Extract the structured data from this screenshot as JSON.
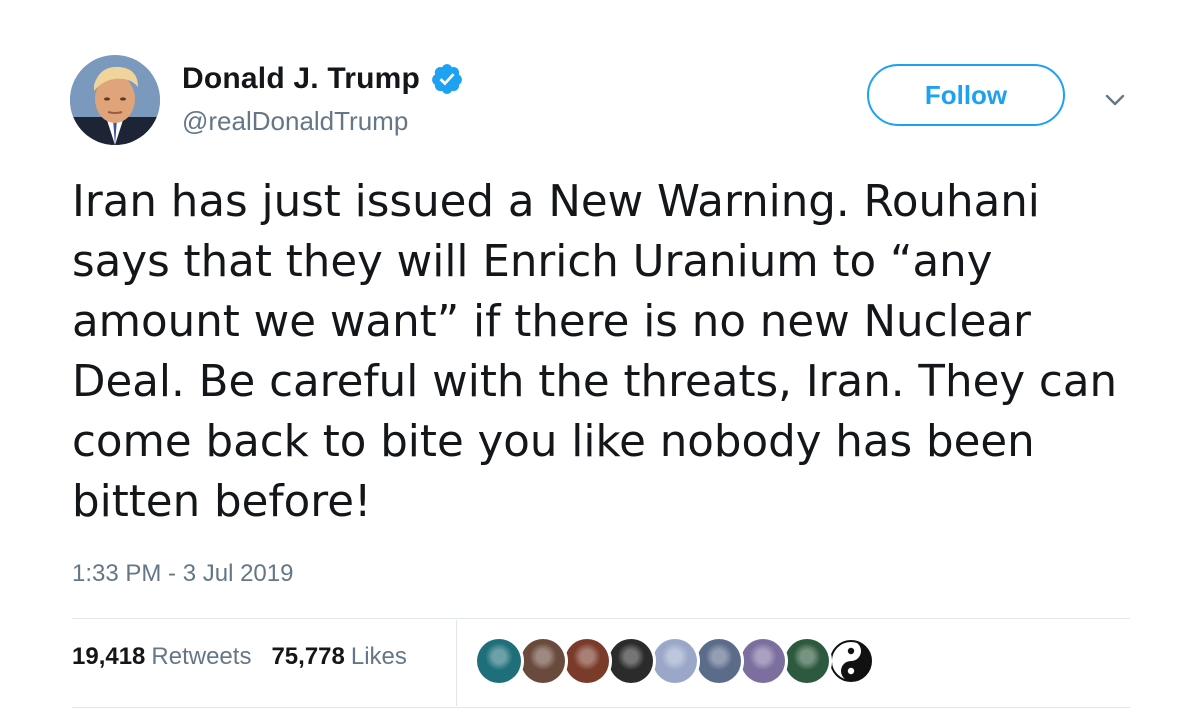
{
  "author": {
    "display_name": "Donald J. Trump",
    "handle": "@realDonaldTrump",
    "verified": true
  },
  "follow_button": {
    "label": "Follow"
  },
  "tweet": {
    "text": "Iran has just issued a New Warning. Rouhani says that they will Enrich Uranium to “any amount we want” if there is no new Nuclear Deal. Be careful with the threats, Iran. They can come back to bite you like nobody has been bitten before!",
    "timestamp": "1:33 PM - 3 Jul 2019"
  },
  "stats": {
    "retweets_count": "19,418",
    "retweets_label": "Retweets",
    "likes_count": "75,778",
    "likes_label": "Likes"
  },
  "likers": [
    {
      "name": "liker-avatar-1",
      "color": "#1f6f7a"
    },
    {
      "name": "liker-avatar-2",
      "color": "#6a4a3c"
    },
    {
      "name": "liker-avatar-3",
      "color": "#7a3b2a"
    },
    {
      "name": "liker-avatar-4",
      "color": "#2b2b2b"
    },
    {
      "name": "liker-avatar-5",
      "color": "#9aa7c9"
    },
    {
      "name": "liker-avatar-6",
      "color": "#5b6b8a"
    },
    {
      "name": "liker-avatar-7",
      "color": "#7c6fa0"
    },
    {
      "name": "liker-avatar-8",
      "color": "#2d5a3e"
    },
    {
      "name": "liker-avatar-9",
      "color": "#111111"
    }
  ],
  "colors": {
    "accent": "#1da1f2",
    "secondary_text": "#657786",
    "primary_text": "#14171a",
    "divider": "#e1e8ed"
  },
  "icons": {
    "verified": "verified-badge-icon",
    "caret": "chevron-down-icon"
  }
}
